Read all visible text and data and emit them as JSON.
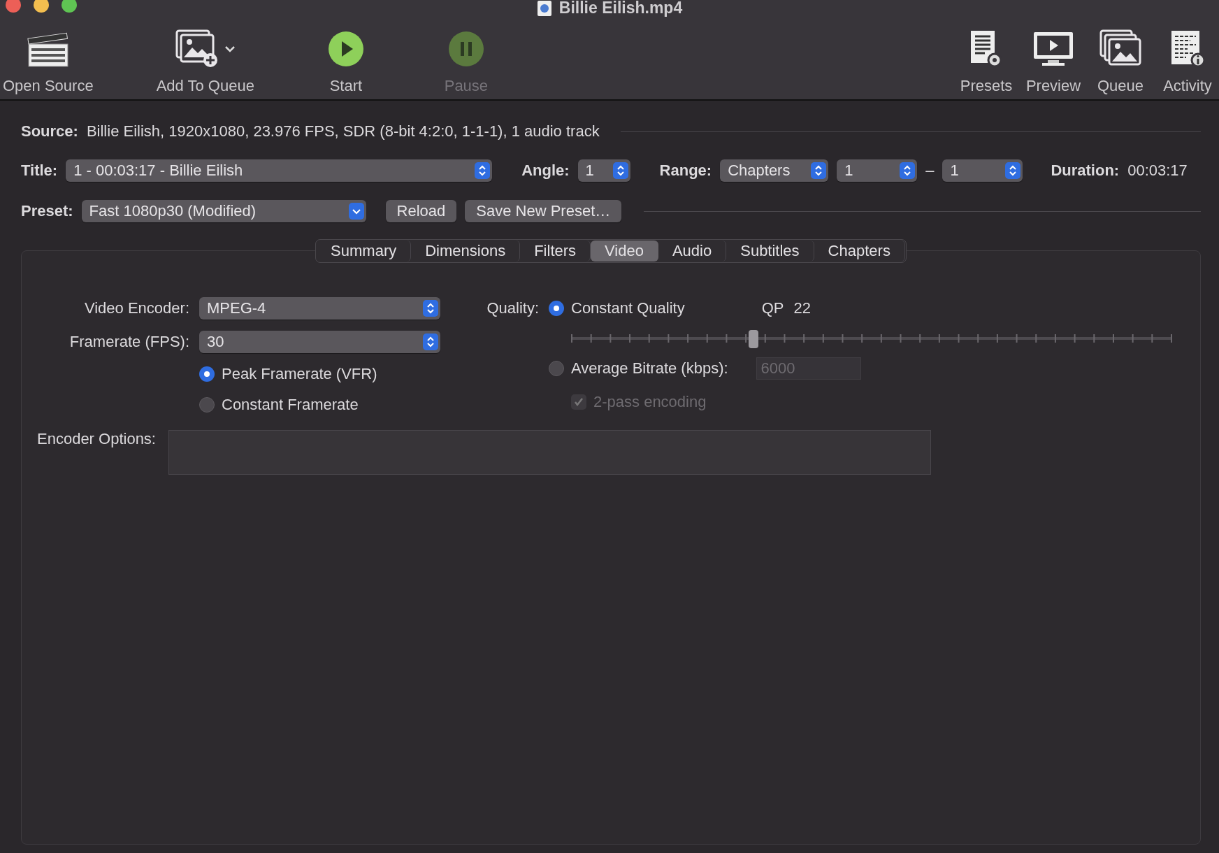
{
  "window": {
    "title": "Billie Eilish.mp4"
  },
  "toolbar": {
    "left": [
      {
        "kind": "open_source",
        "label": "Open Source",
        "disabled": false
      },
      {
        "kind": "add_to_queue",
        "label": "Add To Queue",
        "disabled": false
      },
      {
        "kind": "start",
        "label": "Start",
        "disabled": false
      },
      {
        "kind": "pause",
        "label": "Pause",
        "disabled": true
      }
    ],
    "right": [
      {
        "kind": "presets",
        "label": "Presets",
        "disabled": false
      },
      {
        "kind": "preview",
        "label": "Preview",
        "disabled": false
      },
      {
        "kind": "queue",
        "label": "Queue",
        "disabled": false
      },
      {
        "kind": "activity",
        "label": "Activity",
        "disabled": false
      }
    ]
  },
  "source": {
    "label": "Source:",
    "value": "Billie Eilish, 1920x1080, 23.976 FPS, SDR (8-bit 4:2:0, 1-1-1), 1 audio track"
  },
  "title_row": {
    "title": {
      "label": "Title:",
      "value": "1 - 00:03:17 - Billie Eilish"
    },
    "angle": {
      "label": "Angle:",
      "value": "1"
    },
    "range": {
      "label": "Range:",
      "mode": "Chapters",
      "from": "1",
      "separator": "–",
      "to": "1"
    },
    "duration": {
      "label": "Duration:",
      "value": "00:03:17"
    }
  },
  "preset": {
    "label": "Preset:",
    "value": "Fast 1080p30 (Modified)",
    "buttons": [
      "Reload",
      "Save New Preset…"
    ]
  },
  "tabs": [
    {
      "label": "Summary",
      "selected": false
    },
    {
      "label": "Dimensions",
      "selected": false
    },
    {
      "label": "Filters",
      "selected": false
    },
    {
      "label": "Video",
      "selected": true
    },
    {
      "label": "Audio",
      "selected": false
    },
    {
      "label": "Subtitles",
      "selected": false
    },
    {
      "label": "Chapters",
      "selected": false
    }
  ],
  "video": {
    "encoder": {
      "label": "Video Encoder:",
      "value": "MPEG-4"
    },
    "framerate": {
      "label": "Framerate (FPS):",
      "value": "30"
    },
    "framerate_modes": [
      {
        "label": "Peak Framerate (VFR)",
        "selected": true
      },
      {
        "label": "Constant Framerate",
        "selected": false
      }
    ],
    "quality": {
      "label": "Quality:",
      "modes": [
        {
          "label": "Constant Quality",
          "selected": true
        },
        {
          "label": "Average Bitrate (kbps):",
          "selected": false
        }
      ],
      "qp_label": "QP",
      "qp_value": "22",
      "level": 0.303,
      "bitrate": {
        "value": "6000",
        "disabled": true
      },
      "two_pass": {
        "label": "2-pass encoding",
        "checked": true,
        "disabled": true
      }
    },
    "encoder_options": {
      "label": "Encoder Options:"
    }
  }
}
